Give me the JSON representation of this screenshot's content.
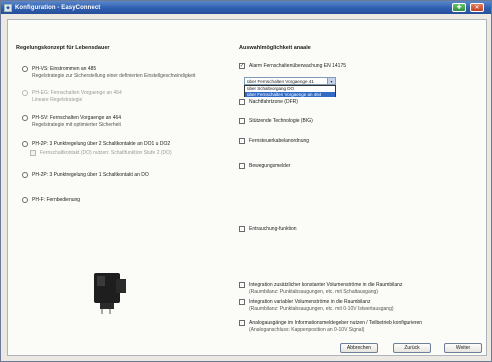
{
  "window": {
    "title": "Konfiguration - EasyConnect"
  },
  "left": {
    "heading": "Regelungskonzept für Lebensdauer",
    "options": [
      {
        "title": "PH-VS: Einstrommen an 485",
        "subtitle": "Regelstrategie zur Sicherstellung einer definierten Einstellgeschwindigkeit",
        "disabled": false
      },
      {
        "title": "PH-EG: Fernschalten Vorgaenge an 464",
        "subtitle": "Lineare Regelstrategie",
        "disabled": true
      },
      {
        "title": "PH-SV: Fernschalten Vorgaenge an 464",
        "subtitle": "Regelstrategie mit optimierter Sicherheit",
        "disabled": false
      },
      {
        "title": "PH-2P: 3 Punktregelung über 2 Schaltkontakte an DO1 u DO2",
        "subtitle": "",
        "disabled": false
      },
      {
        "title": "PH-2P: 3 Punktregelung über 1 Schaltkontakt an DO",
        "subtitle": "",
        "disabled": false
      },
      {
        "title": "PH-F: Fernbedienung",
        "subtitle": "",
        "disabled": false
      }
    ],
    "sub_option": "Fernschaltkontakt (DO) nutzen: Schaltfunktion Stufe 2 (DO)"
  },
  "right": {
    "heading": "Auswahlmöglichkeit anaale",
    "alarm_label": "Alarm Fernschaltenüberwachung EN 14175",
    "alarm_checked": "✓",
    "combo_value": "über Fernschalten Vorgaenge 41",
    "combo_arrow": "▾",
    "dropdown_items": [
      "über Schaltvorgang DO",
      "über Fernschalten Vorgaenge an 464"
    ],
    "options": [
      {
        "label": "Nachtfahrtzone (DFR)"
      },
      {
        "label": "Stützende Technologie (BIG)"
      },
      {
        "label": "Fernsteuerkabelanordnung"
      },
      {
        "label": "Bewegungsmelder"
      },
      {
        "label": "Entrauchung-funktion"
      }
    ],
    "integrations": [
      {
        "title": "Integration zusätzlicher konstanter Volumenströme in die Raumbilanz",
        "subtitle": "(Raumbilanz: Punktabsaugungen, etc. mit Schaltausgang)"
      },
      {
        "title": "Integration variabler Volumenströme in die Raumbilanz",
        "subtitle": "(Raumbilanz: Punktabsaugungen, etc. mit 0-10V Istwertausgang)"
      },
      {
        "title": "Analogausgänge im Informationsmeldegeber nutzen / Teilbetrieb konfigurieren",
        "subtitle": "(Analoganschluss: Kappenposition an 0-10V Signal)"
      }
    ]
  },
  "footer": {
    "cancel": "Abbrechen",
    "back": "Zurück",
    "next": "Weiter"
  },
  "colors": {
    "title_bar": "#2e5fb0",
    "accent_green": "#2f8f3a",
    "accent_red": "#c1401f",
    "selection": "#316ac5"
  }
}
